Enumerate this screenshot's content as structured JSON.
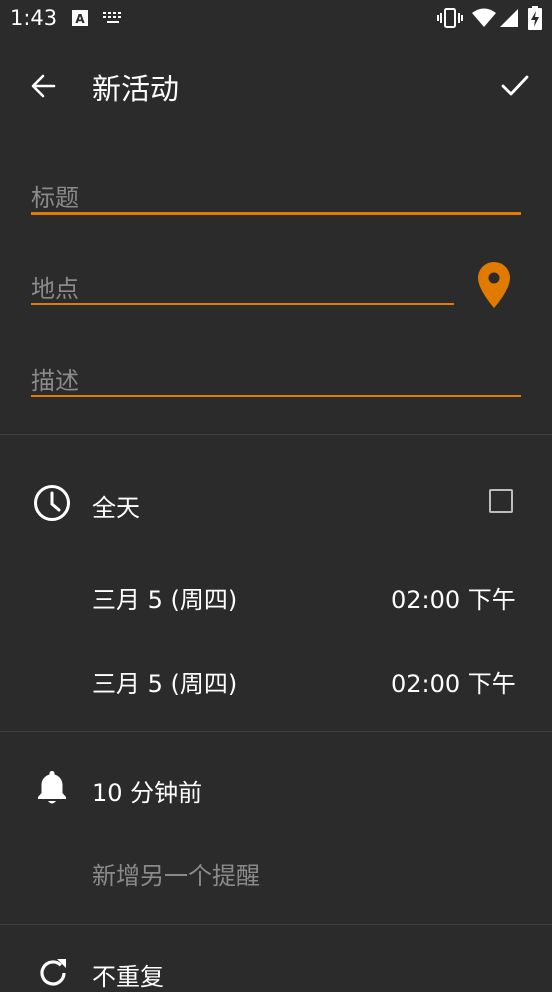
{
  "status_bar": {
    "time": "1:43",
    "icons": [
      "text-icon",
      "keyboard-icon",
      "vibrate-icon",
      "wifi-icon",
      "signal-icon",
      "battery-icon"
    ]
  },
  "toolbar": {
    "title": "新活动",
    "back_icon": "back-arrow-icon",
    "save_icon": "check-icon"
  },
  "form": {
    "title_placeholder": "标题",
    "location_placeholder": "地点",
    "description_placeholder": "描述"
  },
  "time_section": {
    "all_day_label": "全天",
    "all_day_checked": false,
    "start_date": "三月 5 (周四)",
    "start_time": "02:00 下午",
    "end_date": "三月 5 (周四)",
    "end_time": "02:00 下午"
  },
  "reminder_section": {
    "reminder": "10 分钟前",
    "add_reminder": "新增另一个提醒"
  },
  "repeat_section": {
    "label": "不重复"
  },
  "colors": {
    "background": "#2b2b2b",
    "accent": "#e07b00",
    "muted_text": "#8a8a8a",
    "divider": "#3f3f3f"
  }
}
